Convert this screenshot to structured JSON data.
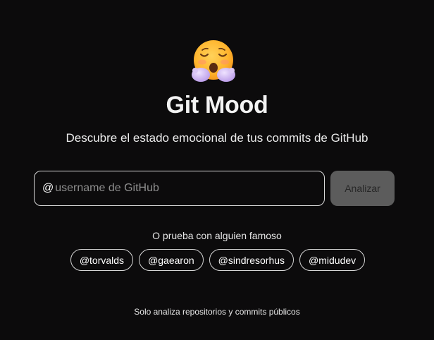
{
  "app": {
    "emoji_icon": "smiling-face-with-open-hands-icon",
    "title": "Git Mood",
    "subtitle": "Descubre el estado emocional de tus commits de GitHub"
  },
  "search": {
    "prefix": "@",
    "placeholder": "username de GitHub",
    "value": "",
    "button_label": "Analizar"
  },
  "suggestions": {
    "label": "O prueba con alguien famoso",
    "users": [
      "@torvalds",
      "@gaearon",
      "@sindresorhus",
      "@midudev"
    ]
  },
  "footer": {
    "note": "Solo analiza repositorios y commits públicos"
  },
  "colors": {
    "background": "#0c0b0c",
    "button_disabled": "#5c5c5c",
    "emoji_face": "#ffb83a",
    "emoji_hands": "#c9b2f0"
  }
}
